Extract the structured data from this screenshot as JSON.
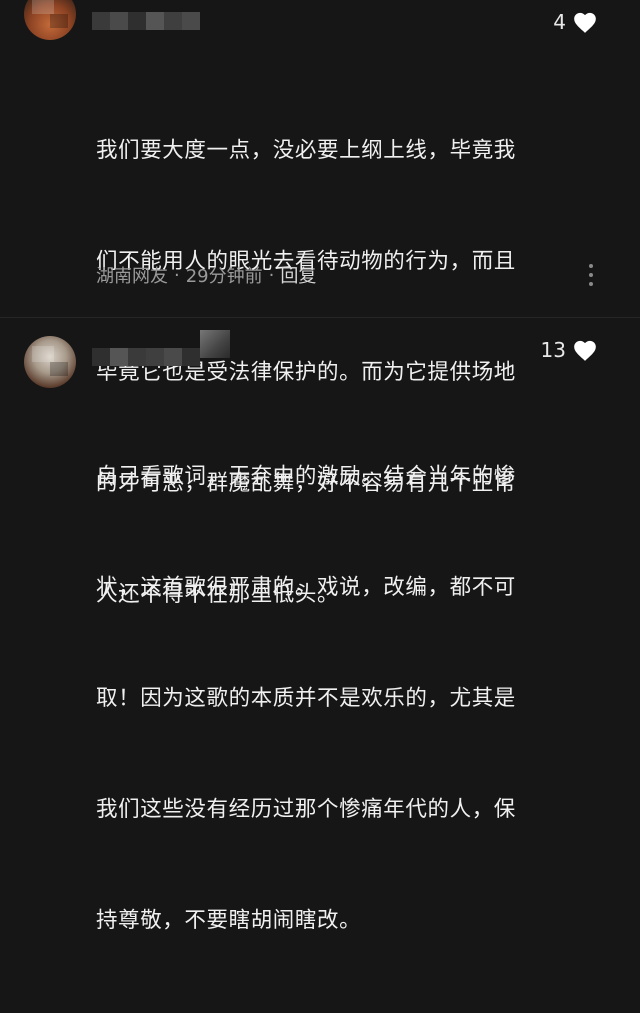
{
  "comments": [
    {
      "likes": "4",
      "lines": [
        "我们要大度一点，没必要上纲上线，毕竟我",
        "们不能用人的眼光去看待动物的行为，而且",
        "毕竟它也是受法律保护的。而为它提供场地",
        "的才可恶，群魔乱舞，好不容易有几个正常",
        "人还不得不在那里低头。"
      ],
      "location": "湖南网友",
      "time": "29分钟前",
      "separator": "·",
      "reply_label": "回复"
    },
    {
      "likes": "13",
      "lines": [
        "自己看歌词，无奈中的激励。结合当年的惨",
        "状，这首歌很严肃的。戏说，改编，都不可",
        "取！因为这歌的本质并不是欢乐的，尤其是",
        "我们这些没有经历过那个惨痛年代的人，保",
        "持尊敬，不要瞎胡闹瞎改。"
      ]
    }
  ],
  "icons": {
    "like": "heart-icon",
    "more": "more-vertical-icon"
  },
  "colors": {
    "background": "#161616",
    "text": "#f0f0f0",
    "meta": "#9a9a9a"
  }
}
